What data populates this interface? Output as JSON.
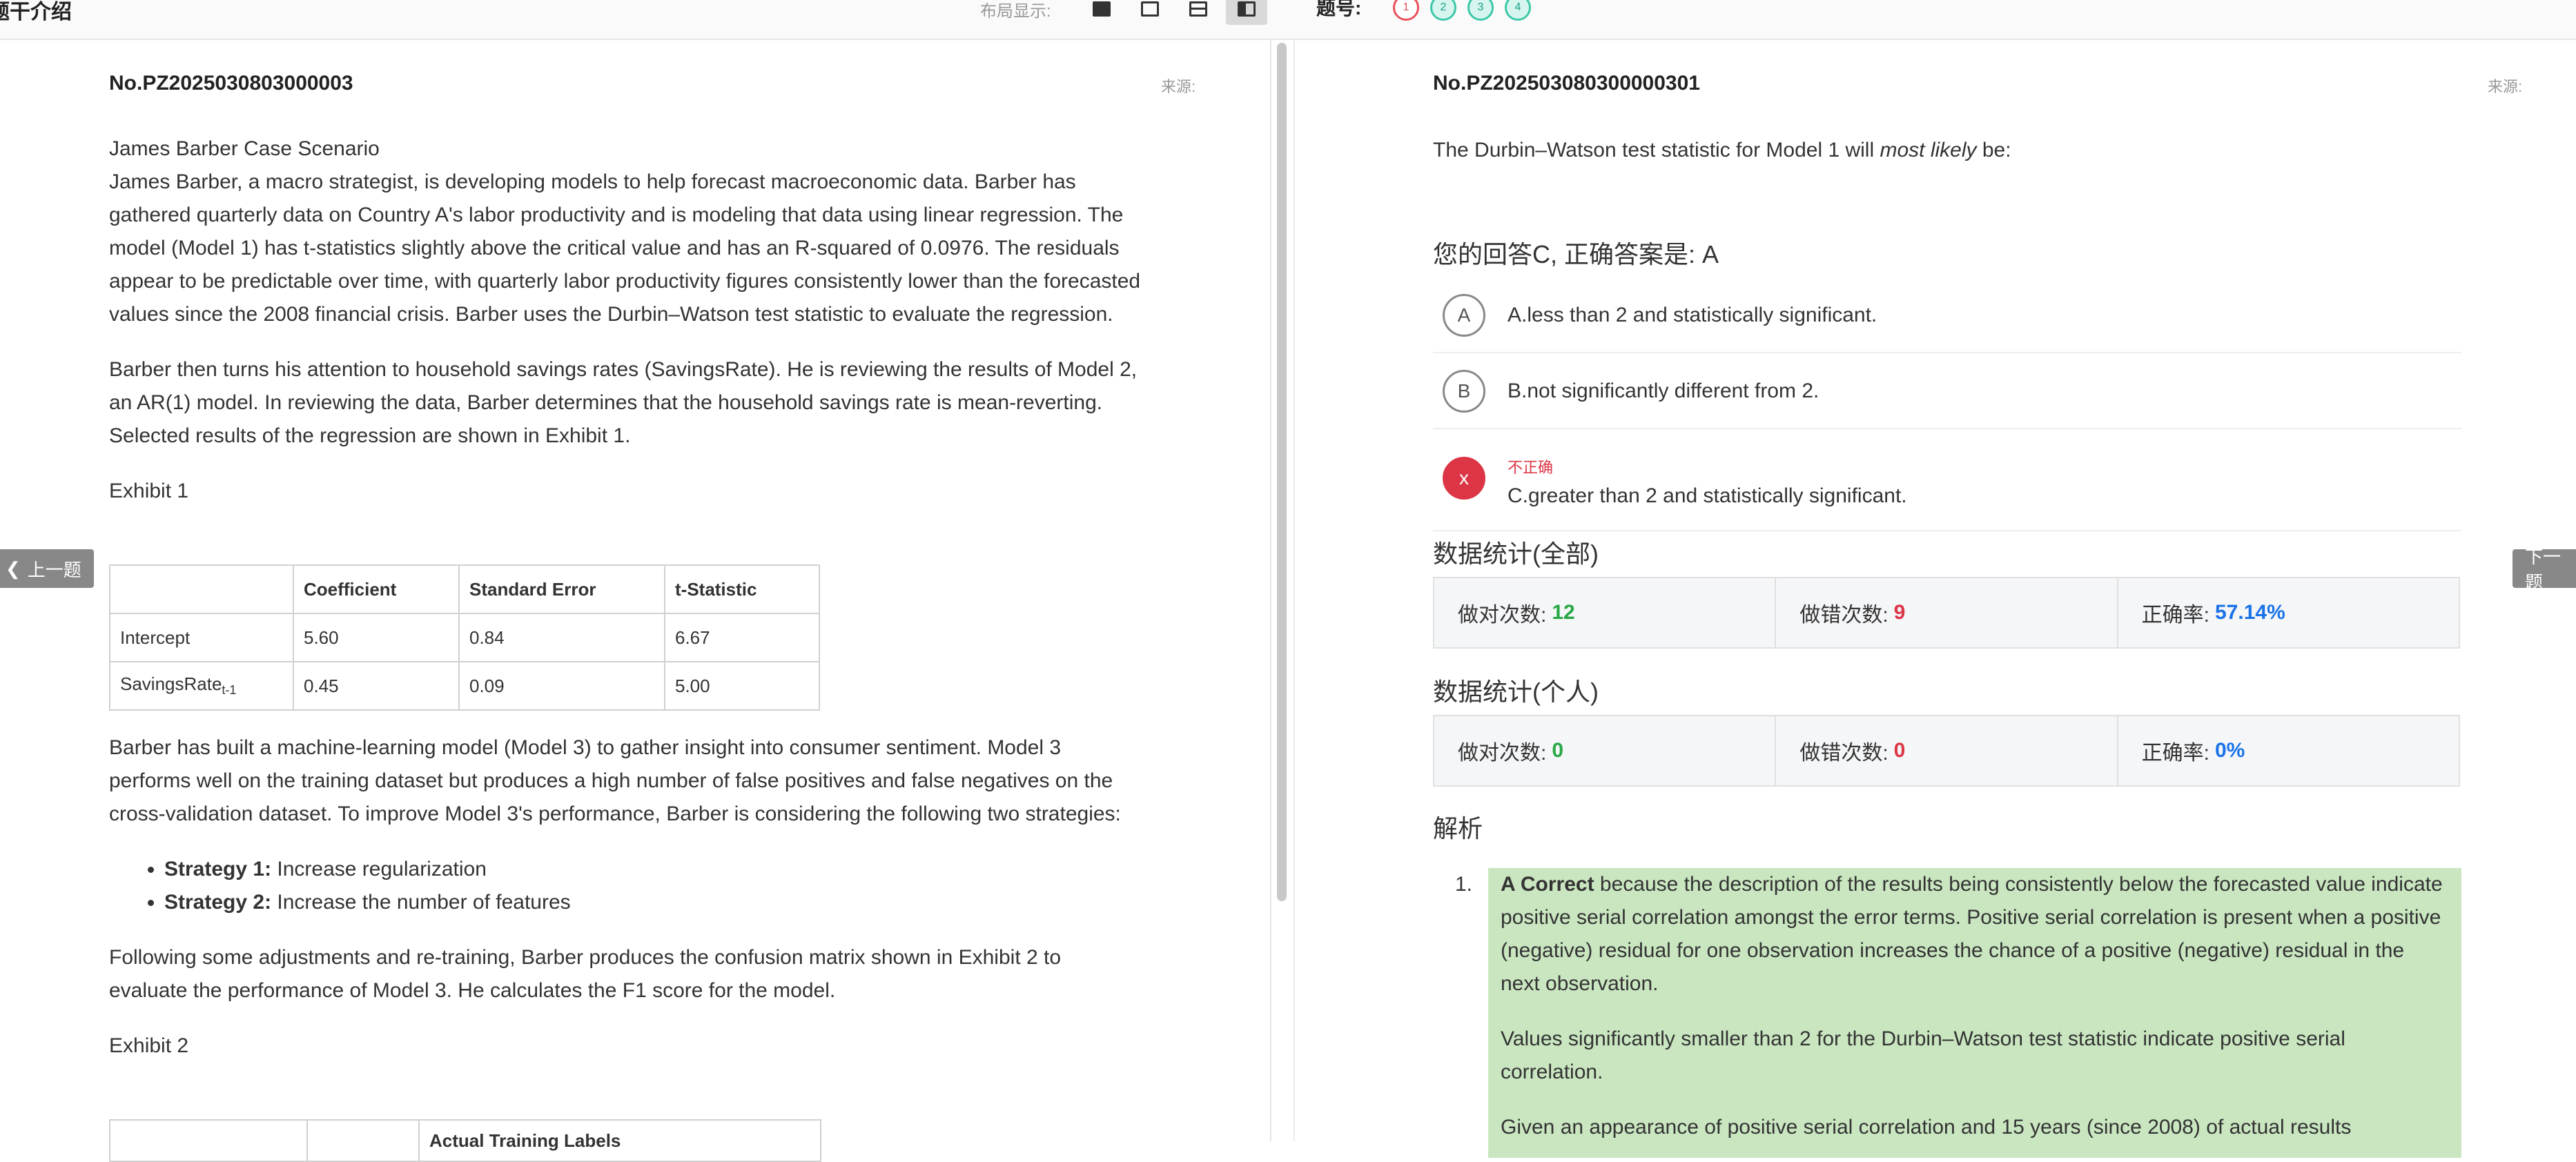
{
  "topbar": {
    "title": "题干介绍",
    "layout_label": "布局显示:",
    "question_number_label": "题号:",
    "question_dots": [
      "1",
      "2",
      "3",
      "4"
    ]
  },
  "left": {
    "question_id": "No.PZ2025030803000003",
    "source_label": "来源:",
    "case_title": "James Barber Case Scenario",
    "para1": "James Barber, a macro strategist, is developing models to help forecast macroeconomic data. Barber has gathered quarterly data on Country A's labor productivity and is modeling that data using linear regression. The model (Model 1) has t-statistics slightly above the critical value and has an R-squared of 0.0976. The residuals appear to be predictable over time, with quarterly labor productivity figures consistently lower than the forecasted values since the 2008 financial crisis. Barber uses the Durbin–Watson test statistic to evaluate the regression.",
    "para2": "Barber then turns his attention to household savings rates (SavingsRate). He is reviewing the results of Model 2, an AR(1) model. In reviewing the data, Barber determines that the household savings rate is mean-reverting. Selected results of the regression are shown in Exhibit 1.",
    "exhibit1_label": "Exhibit 1",
    "exhibit1": {
      "headers": [
        "",
        "Coefficient",
        "Standard Error",
        "t-Statistic"
      ],
      "rows": [
        {
          "name": "Intercept",
          "sub": "",
          "coef": "5.60",
          "se": "0.84",
          "t": "6.67"
        },
        {
          "name": "SavingsRate",
          "sub": "t-1",
          "coef": "0.45",
          "se": "0.09",
          "t": "5.00"
        }
      ]
    },
    "para3": "Barber has built a machine-learning model (Model 3) to gather insight into consumer sentiment. Model 3 performs well on the training dataset but produces a high number of false positives and false negatives on the cross-validation dataset. To improve Model 3's performance, Barber is considering the following two strategies:",
    "strategies": [
      {
        "label": "Strategy 1:",
        "text": " Increase regularization"
      },
      {
        "label": "Strategy 2:",
        "text": " Increase the number of features"
      }
    ],
    "para4": "Following some adjustments and re-training, Barber produces the confusion matrix shown in Exhibit 2 to evaluate the performance of Model 3. He calculates the F1 score for the model.",
    "exhibit2_label": "Exhibit 2",
    "exhibit2_header": "Actual Training Labels",
    "prev_button": "上一题"
  },
  "right": {
    "question_id": "No.PZ202503080300000301",
    "source_label": "来源:",
    "question_pre": "The Durbin–Watson test statistic for Model 1 will ",
    "question_em": "most likely",
    "question_post": " be:",
    "answer_line": "您的回答C, 正确答案是: A",
    "options": [
      {
        "letter": "A",
        "text": "A.less than 2 and statistically significant."
      },
      {
        "letter": "B",
        "text": "B.not significantly different from 2."
      },
      {
        "letter": "x",
        "tag": "不正确",
        "text": "C.greater than 2 and statistically significant."
      }
    ],
    "stats_all": {
      "title": "数据统计(全部)",
      "correct_label": "做对次数:",
      "correct": "12",
      "wrong_label": "做错次数:",
      "wrong": "9",
      "rate_label": "正确率:",
      "rate": "57.14%"
    },
    "stats_personal": {
      "title": "数据统计(个人)",
      "correct_label": "做对次数:",
      "correct": "0",
      "wrong_label": "做错次数:",
      "wrong": "0",
      "rate_label": "正确率:",
      "rate": "0%"
    },
    "analysis_title": "解析",
    "analysis_num": "1.",
    "analysis_bold": "A Correct",
    "analysis_p1": " because the description of the results being consistently below the forecasted value indicate positive serial correlation amongst the error terms. Positive serial correlation is present when a positive (negative) residual for one observation increases the chance of a positive (negative) residual in the next observation.",
    "analysis_p2": "Values significantly smaller than 2 for the Durbin–Watson test statistic indicate positive serial correlation.",
    "analysis_p3": "Given an appearance of positive serial correlation and 15 years (since 2008) of actual results",
    "next_button": "下一题"
  },
  "colors": {
    "wrong": "#dc3545",
    "correct": "#28a745",
    "rate": "#1a73e8",
    "analysis_bg": "#c9e6c0"
  }
}
